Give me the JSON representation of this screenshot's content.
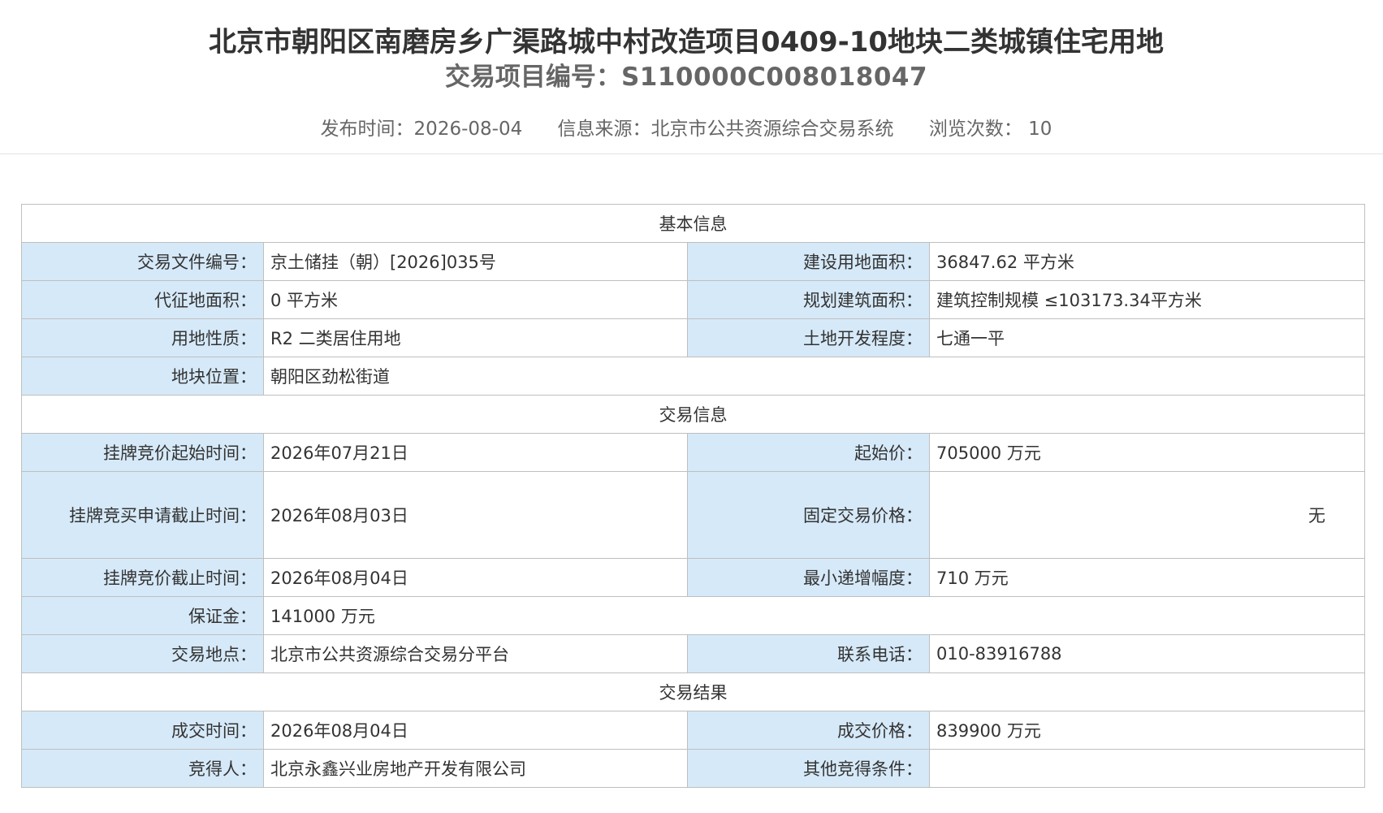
{
  "header": {
    "title": "北京市朝阳区南磨房乡广渠路城中村改造项目0409-10地块二类城镇住宅用地",
    "project_code_label": "交易项目编号：",
    "project_code": "S110000C008018047"
  },
  "meta": {
    "publish_label": "发布时间：",
    "publish_date": "2026-08-04",
    "source_label": "信息来源：",
    "source": "北京市公共资源综合交易系统",
    "views_label": "浏览次数：",
    "views": "10"
  },
  "sections": {
    "basic": "基本信息",
    "trade": "交易信息",
    "result": "交易结果"
  },
  "basic": {
    "doc_no_label": "交易文件编号：",
    "doc_no": "京土储挂（朝）[2026]035号",
    "land_area_label": "建设用地面积：",
    "land_area": "36847.62 平方米",
    "proxy_area_label": "代征地面积：",
    "proxy_area": "0 平方米",
    "plan_area_label": "规划建筑面积：",
    "plan_area": "建筑控制规模 ≤103173.34平方米",
    "land_use_label": "用地性质：",
    "land_use": "R2 二类居住用地",
    "dev_level_label": "土地开发程度：",
    "dev_level": "七通一平",
    "location_label": "地块位置：",
    "location": "朝阳区劲松街道"
  },
  "trade": {
    "bid_start_label": "挂牌竞价起始时间：",
    "bid_start": "2026年07月21日",
    "start_price_label": "起始价：",
    "start_price": "705000 万元",
    "apply_deadline_label": "挂牌竞买申请截止时间：",
    "apply_deadline": "2026年08月03日",
    "fixed_price_label": "固定交易价格：",
    "fixed_price": "无",
    "bid_end_label": "挂牌竞价截止时间：",
    "bid_end": "2026年08月04日",
    "min_increment_label": "最小递增幅度：",
    "min_increment": "710 万元",
    "deposit_label": "保证金：",
    "deposit": "141000 万元",
    "venue_label": "交易地点：",
    "venue": "北京市公共资源综合交易分平台",
    "phone_label": "联系电话：",
    "phone": "010-83916788"
  },
  "result": {
    "deal_time_label": "成交时间：",
    "deal_time": "2026年08月04日",
    "deal_price_label": "成交价格：",
    "deal_price": "839900 万元",
    "winner_label": "竞得人：",
    "winner": "北京永鑫兴业房地产开发有限公司",
    "other_label": "其他竞得条件：",
    "other": ""
  }
}
